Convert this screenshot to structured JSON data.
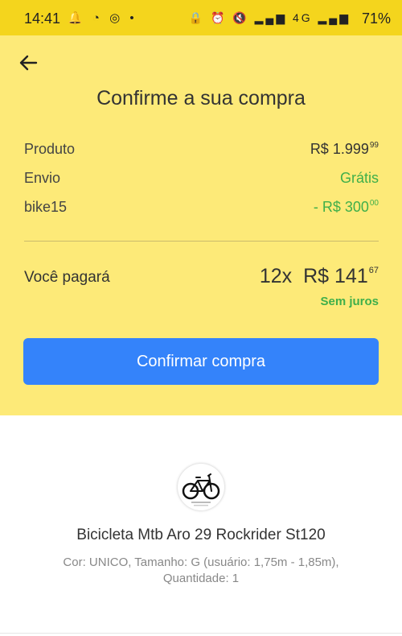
{
  "status_bar": {
    "time": "14:41",
    "left_icons": "🔔 ◔ ◎ •",
    "right_icons": "🔒 ⏰ 🔇 ▂▄▆ 4G ▂▄▆",
    "battery": "71%"
  },
  "header": {
    "back_icon": "arrow-left-icon",
    "title": "Confirme a sua compra"
  },
  "summary": {
    "product_label": "Produto",
    "product_price": "R$ 1.999",
    "product_price_cents": "99",
    "shipping_label": "Envio",
    "shipping_value": "Grátis",
    "coupon_label": "bike15",
    "coupon_value": "- R$ 300",
    "coupon_value_cents": "00"
  },
  "payment": {
    "label": "Você pagará",
    "installments": "12x",
    "amount": "R$ 141",
    "amount_cents": "67",
    "interest_note": "Sem juros"
  },
  "actions": {
    "confirm_label": "Confirmar compra"
  },
  "product": {
    "name": "Bicicleta Mtb Aro 29  Rockrider St120",
    "details": "Cor: UNICO, Tamanho: G (usuário: 1,75m - 1,85m), Quantidade: 1"
  },
  "colors": {
    "status_bar": "#f4d51d",
    "panel": "#fdea78",
    "accent_blue": "#3483fa",
    "green": "#3faf4a"
  }
}
